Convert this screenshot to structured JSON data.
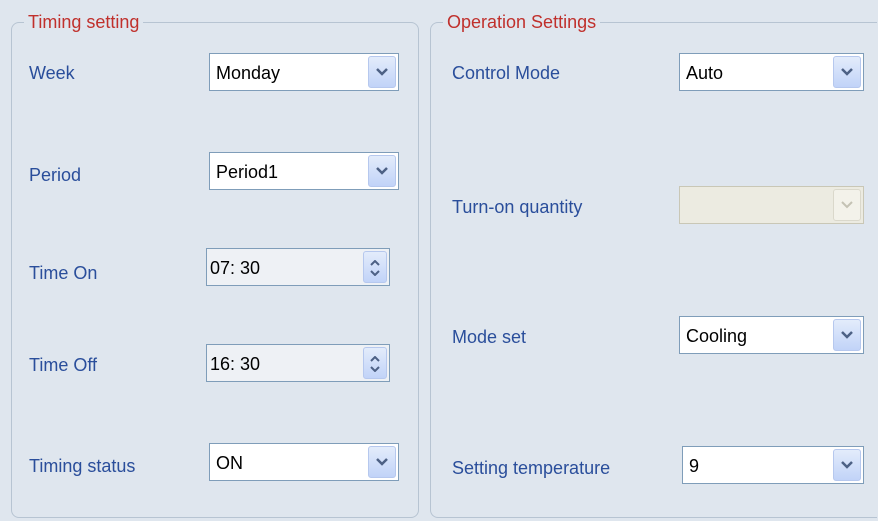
{
  "timing": {
    "title": "Timing setting",
    "week": {
      "label": "Week",
      "value": "Monday"
    },
    "period": {
      "label": "Period",
      "value": "Period1"
    },
    "time_on": {
      "label": "Time On",
      "value": "07:  30"
    },
    "time_off": {
      "label": "Time Off",
      "value": "16:  30"
    },
    "status": {
      "label": "Timing status",
      "value": "ON"
    }
  },
  "operation": {
    "title": "Operation Settings",
    "control_mode": {
      "label": "Control Mode",
      "value": "Auto"
    },
    "turn_on_quantity": {
      "label": "Turn-on quantity",
      "value": "",
      "disabled": true
    },
    "mode_set": {
      "label": "Mode set",
      "value": "Cooling"
    },
    "setting_temperature": {
      "label": "Setting temperature",
      "value": "9"
    }
  },
  "colors": {
    "background": "#dfe6ee",
    "group_title": "#c0302c",
    "label": "#2a4e9b"
  },
  "icons": {
    "dropdown": "chevron-down-icon",
    "spin": "spin-up-down-icon"
  }
}
